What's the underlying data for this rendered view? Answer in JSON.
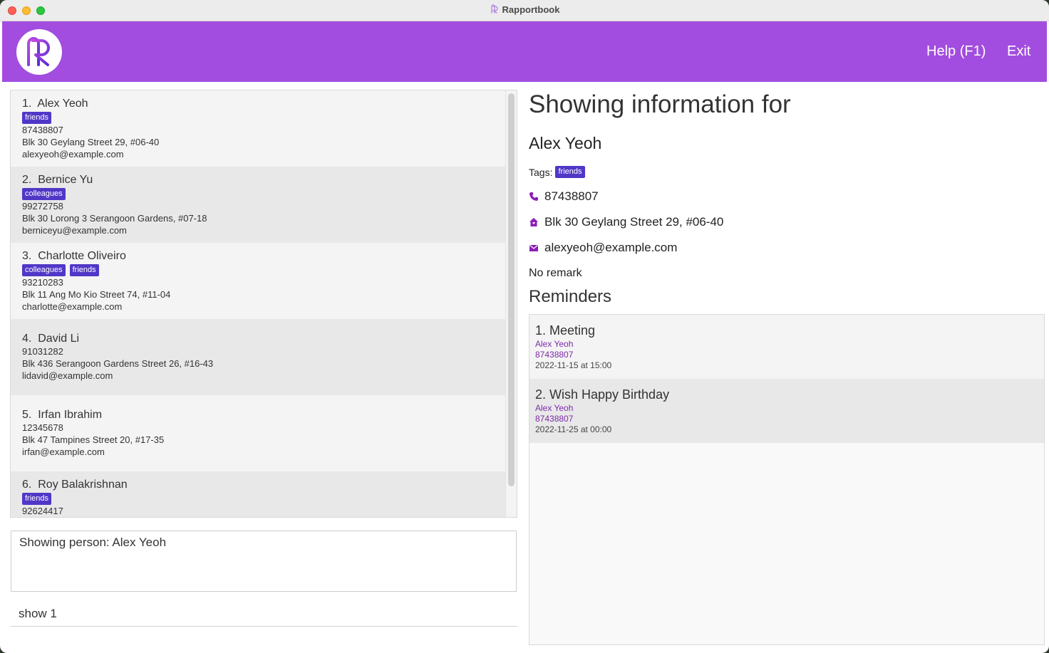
{
  "window": {
    "title": "Rapportbook"
  },
  "header": {
    "help_label": "Help (F1)",
    "exit_label": "Exit"
  },
  "persons": [
    {
      "index": "1.",
      "name": "Alex Yeoh",
      "tags": [
        "friends"
      ],
      "phone": "87438807",
      "address": "Blk 30 Geylang Street 29, #06-40",
      "email": "alexyeoh@example.com"
    },
    {
      "index": "2.",
      "name": "Bernice Yu",
      "tags": [
        "colleagues"
      ],
      "phone": "99272758",
      "address": "Blk 30 Lorong 3 Serangoon Gardens, #07-18",
      "email": "berniceyu@example.com"
    },
    {
      "index": "3.",
      "name": "Charlotte Oliveiro",
      "tags": [
        "colleagues",
        "friends"
      ],
      "phone": "93210283",
      "address": "Blk 11 Ang Mo Kio Street 74, #11-04",
      "email": "charlotte@example.com"
    },
    {
      "index": "4.",
      "name": "David Li",
      "tags": [],
      "phone": "91031282",
      "address": "Blk 436 Serangoon Gardens Street 26, #16-43",
      "email": "lidavid@example.com"
    },
    {
      "index": "5.",
      "name": "Irfan Ibrahim",
      "tags": [],
      "phone": "12345678",
      "address": "Blk 47 Tampines Street 20, #17-35",
      "email": "irfan@example.com"
    },
    {
      "index": "6.",
      "name": "Roy Balakrishnan",
      "tags": [
        "friends"
      ],
      "phone": "92624417",
      "address": "",
      "email": ""
    }
  ],
  "result": {
    "text": "Showing person: Alex Yeoh"
  },
  "command": {
    "value": "show 1"
  },
  "detail": {
    "heading": "Showing information for",
    "name": "Alex Yeoh",
    "tags_label": "Tags:",
    "tags": [
      "friends"
    ],
    "phone": "87438807",
    "address": "Blk 30 Geylang Street 29, #06-40",
    "email": "alexyeoh@example.com",
    "remark": "No remark",
    "reminders_heading": "Reminders"
  },
  "reminders": [
    {
      "title": "1. Meeting",
      "person": "Alex Yeoh",
      "phone": "87438807",
      "datetime": "2022-11-15 at 15:00"
    },
    {
      "title": "2. Wish Happy Birthday",
      "person": "Alex Yeoh",
      "phone": "87438807",
      "datetime": "2022-11-25 at 00:00"
    }
  ],
  "colors": {
    "header": "#a24ddf",
    "tag": "#5137c7",
    "icon": "#8a1fb5"
  }
}
